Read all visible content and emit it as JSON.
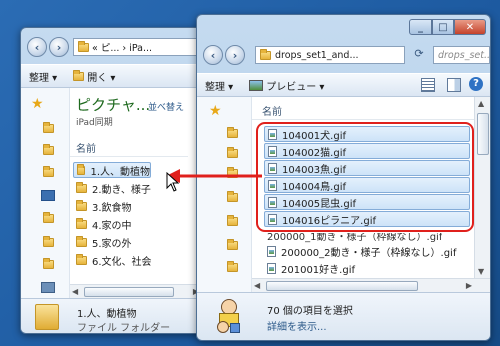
{
  "back_window": {
    "breadcrumb": "« ピ... › iPa...",
    "toolbar": {
      "organize": "整理 ▾",
      "open": "開く ▾"
    },
    "title": "ピクチャ...",
    "subtitle": "iPad同期",
    "arrange": "並べ替え",
    "column_header": "名前",
    "folders": [
      {
        "label": "1.人、動植物",
        "selected": true
      },
      {
        "label": "2.動き、様子",
        "selected": false
      },
      {
        "label": "3.飲食物",
        "selected": false
      },
      {
        "label": "4.家の中",
        "selected": false
      },
      {
        "label": "5.家の外",
        "selected": false
      },
      {
        "label": "6.文化、社会",
        "selected": false
      }
    ],
    "details": {
      "name": "1.人、動植物",
      "type": "ファイル フォルダー"
    }
  },
  "front_window": {
    "breadcrumb": "drops_set1_and...",
    "search_placeholder": "drops_set...",
    "toolbar": {
      "organize": "整理 ▾",
      "preview": "プレビュー ▾"
    },
    "column_header": "名前",
    "files": [
      {
        "label": "104001犬.gif",
        "selected": true
      },
      {
        "label": "104002猫.gif",
        "selected": true
      },
      {
        "label": "104003魚.gif",
        "selected": true
      },
      {
        "label": "104004鳥.gif",
        "selected": true
      },
      {
        "label": "104005昆虫.gif",
        "selected": true
      },
      {
        "label": "104016ピラニア.gif",
        "selected": true
      },
      {
        "label": "200000_2動き・様子（枠線なし）.gif",
        "selected": false
      },
      {
        "label": "201001好き.gif",
        "selected": false
      }
    ],
    "partial_file": "200000_1動き・様子（枠線なし）.gif",
    "status": {
      "selected": "70 個の項目を選択",
      "link": "詳細を表示..."
    }
  },
  "colors": {
    "highlight_border": "#e0201c",
    "arrow": "#e0201c"
  }
}
